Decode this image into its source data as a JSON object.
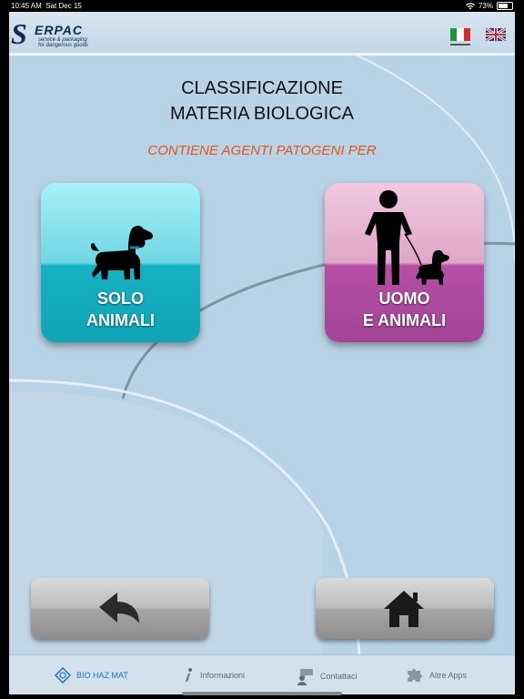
{
  "status_bar": {
    "time": "10:45 AM",
    "date": "Sat Dec 15",
    "battery": "73%",
    "battery_level": 0.73
  },
  "header": {
    "logo_letter": "S",
    "logo_word": "ERPAC",
    "logo_line1": "service & packaging",
    "logo_line2": "for dangerous goods",
    "languages": [
      "italian-flag",
      "uk-flag"
    ]
  },
  "main": {
    "title_line1": "CLASSIFICAZIONE",
    "title_line2": "MATERIA BIOLOGICA",
    "subtitle": "CONTIENE AGENTI PATOGENI PER",
    "options": [
      {
        "line1": "SOLO",
        "line2": "ANIMALI",
        "icon": "dog-icon"
      },
      {
        "line1": "UOMO",
        "line2": "E ANIMALI",
        "icon": "person-with-dog-icon"
      }
    ]
  },
  "nav": {
    "back_icon": "back-arrow-icon",
    "home_icon": "home-icon"
  },
  "tabs": [
    {
      "label": "BIO HAZ MAT",
      "icon": "biohazmat-icon",
      "active": true
    },
    {
      "label": "Informazioni",
      "icon": "info-icon",
      "active": false
    },
    {
      "label": "Contattaci",
      "icon": "contact-icon",
      "active": false
    },
    {
      "label": "Altre Apps",
      "icon": "puzzle-icon",
      "active": false
    }
  ],
  "colors": {
    "accent": "#1a73c7",
    "subtitle": "#e0551f",
    "tile_a": "#16b1c2",
    "tile_b": "#b54fa4"
  }
}
